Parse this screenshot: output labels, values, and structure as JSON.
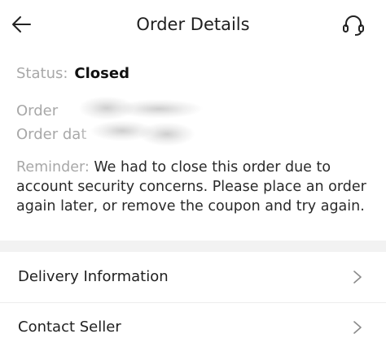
{
  "header": {
    "title": "Order Details",
    "back_icon": "arrow-left-icon",
    "support_icon": "headset-icon"
  },
  "status": {
    "label": "Status:",
    "value": "Closed"
  },
  "order": {
    "number_label": "Order",
    "date_label": "Order dat"
  },
  "reminder": {
    "label": "Reminder:",
    "text": "We had to close this order due to account security concerns. Please place an order again later, or remove the coupon and try again."
  },
  "menu": {
    "items": [
      {
        "label": "Delivery Information",
        "icon": "chevron-right-icon"
      },
      {
        "label": "Contact Seller",
        "icon": "chevron-right-icon"
      }
    ]
  },
  "colors": {
    "muted_label": "#a8a8a8",
    "text": "#222222",
    "section_divider": "#f2f2f2"
  }
}
